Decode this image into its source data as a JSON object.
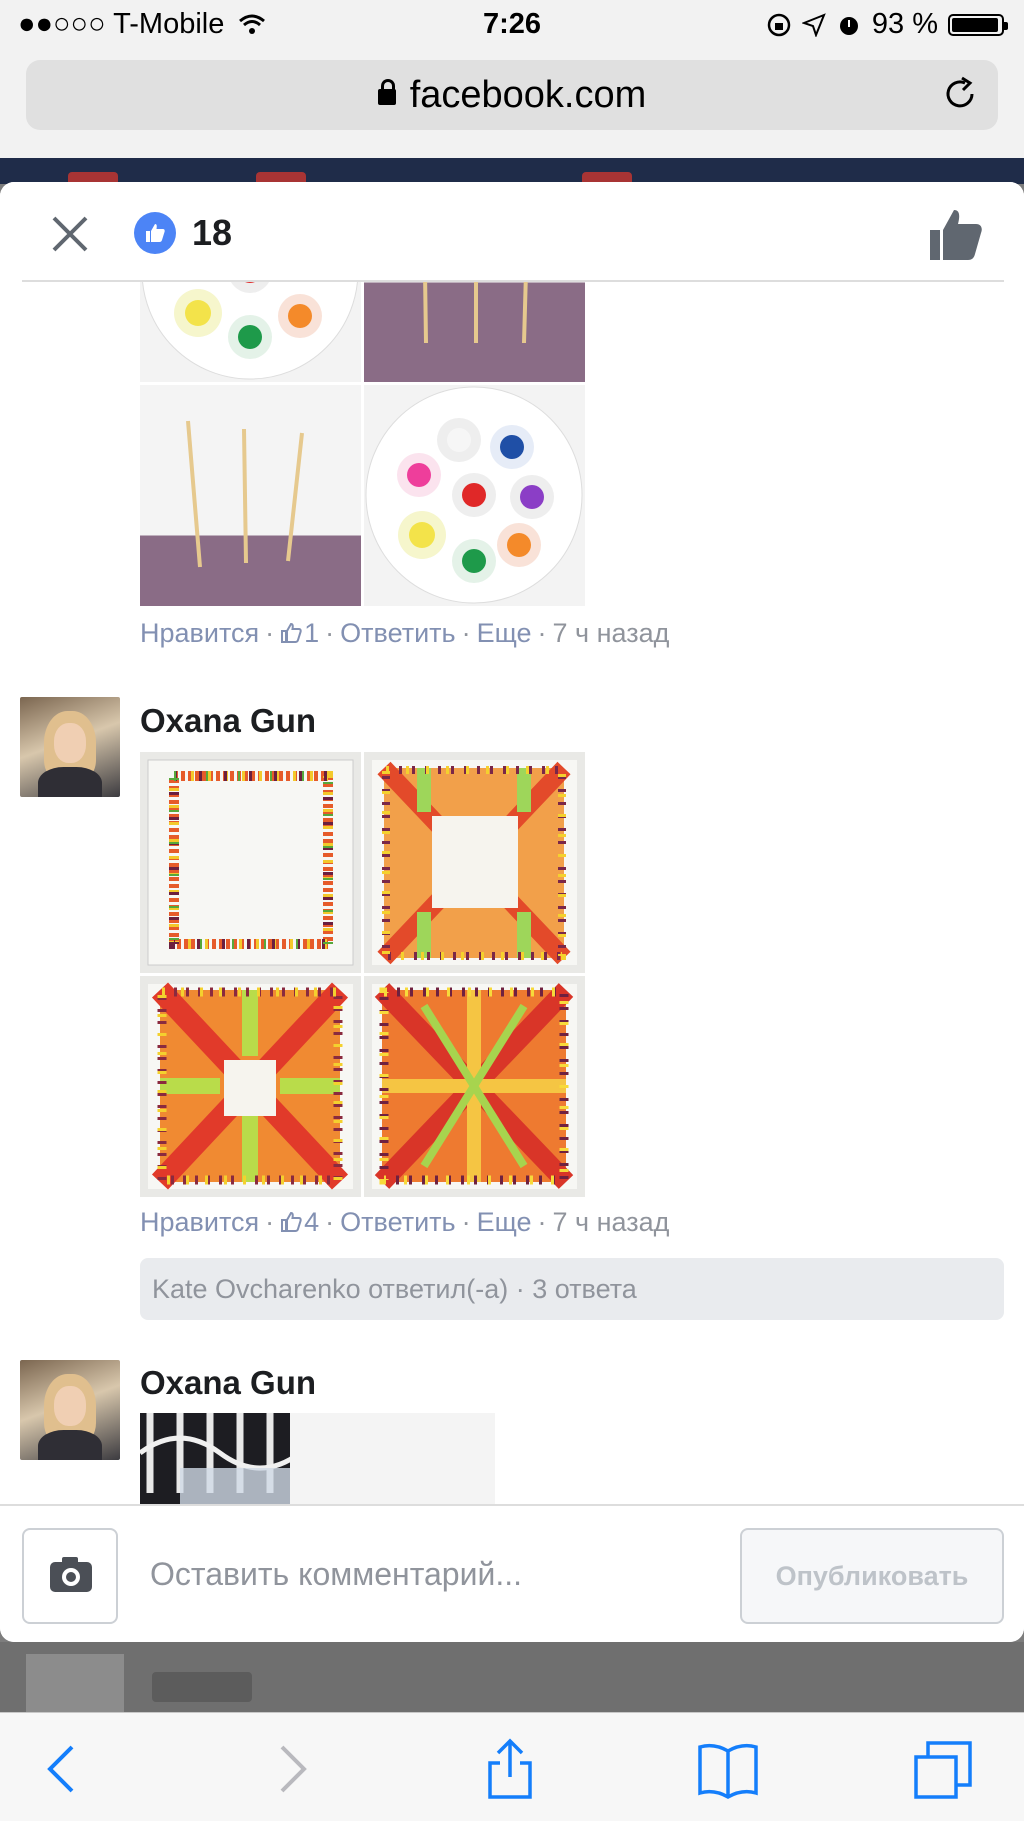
{
  "statusbar": {
    "carrier": "T-Mobile",
    "time": "7:26",
    "battery": "93 %"
  },
  "browser": {
    "url": "facebook.com"
  },
  "modal": {
    "like_count": "18"
  },
  "comments": [
    {
      "actions": {
        "like": "Нравится",
        "likes": "1",
        "reply": "Ответить",
        "more": "Еще",
        "time": "7 ч назад"
      }
    },
    {
      "author": "Oxana Gun",
      "actions": {
        "like": "Нравится",
        "likes": "4",
        "reply": "Ответить",
        "more": "Еще",
        "time": "7 ч назад"
      },
      "replies": "Kate Ovcharenko ответил(-а) · 3 ответа"
    },
    {
      "author": "Oxana Gun"
    }
  ],
  "composer": {
    "placeholder": "Оставить комментарий...",
    "publish": "Опубликовать"
  },
  "colors": {
    "accent": "#4c84f6",
    "link": "#8290b2",
    "meta": "#90949c",
    "ios_blue": "#147efb"
  },
  "icons": [
    "close-icon",
    "like-icon",
    "camera-icon",
    "back-icon",
    "forward-icon",
    "share-icon",
    "bookmarks-icon",
    "tabs-icon",
    "reload-icon",
    "lock-icon",
    "wifi-icon"
  ]
}
